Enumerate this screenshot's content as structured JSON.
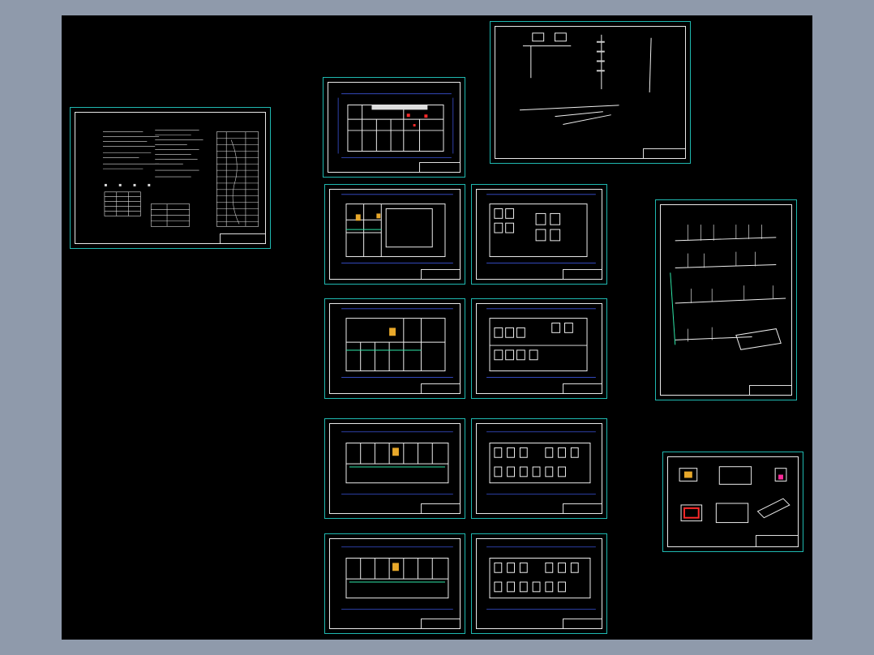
{
  "viewer": {
    "canvas_color": "#000000",
    "background_color": "#8f9aab",
    "sheet_frame_color": "#1fb8b0"
  },
  "sheets": [
    {
      "id": "design-notes",
      "kind": "notes"
    },
    {
      "id": "site-plan",
      "kind": "floorplan-small"
    },
    {
      "id": "water-system-3d",
      "kind": "iso"
    },
    {
      "id": "plan-1-water",
      "kind": "floorplan"
    },
    {
      "id": "plan-1-drain",
      "kind": "floorplan-rooms"
    },
    {
      "id": "plan-2-water",
      "kind": "floorplan"
    },
    {
      "id": "plan-2-drain",
      "kind": "floorplan-rooms"
    },
    {
      "id": "riser-diagram",
      "kind": "riser"
    },
    {
      "id": "plan-3-water",
      "kind": "floorplan-long"
    },
    {
      "id": "plan-3-drain",
      "kind": "floorplan-long-rooms"
    },
    {
      "id": "details",
      "kind": "details"
    },
    {
      "id": "plan-4-water",
      "kind": "floorplan-long"
    },
    {
      "id": "plan-4-drain",
      "kind": "floorplan-long-rooms"
    }
  ]
}
